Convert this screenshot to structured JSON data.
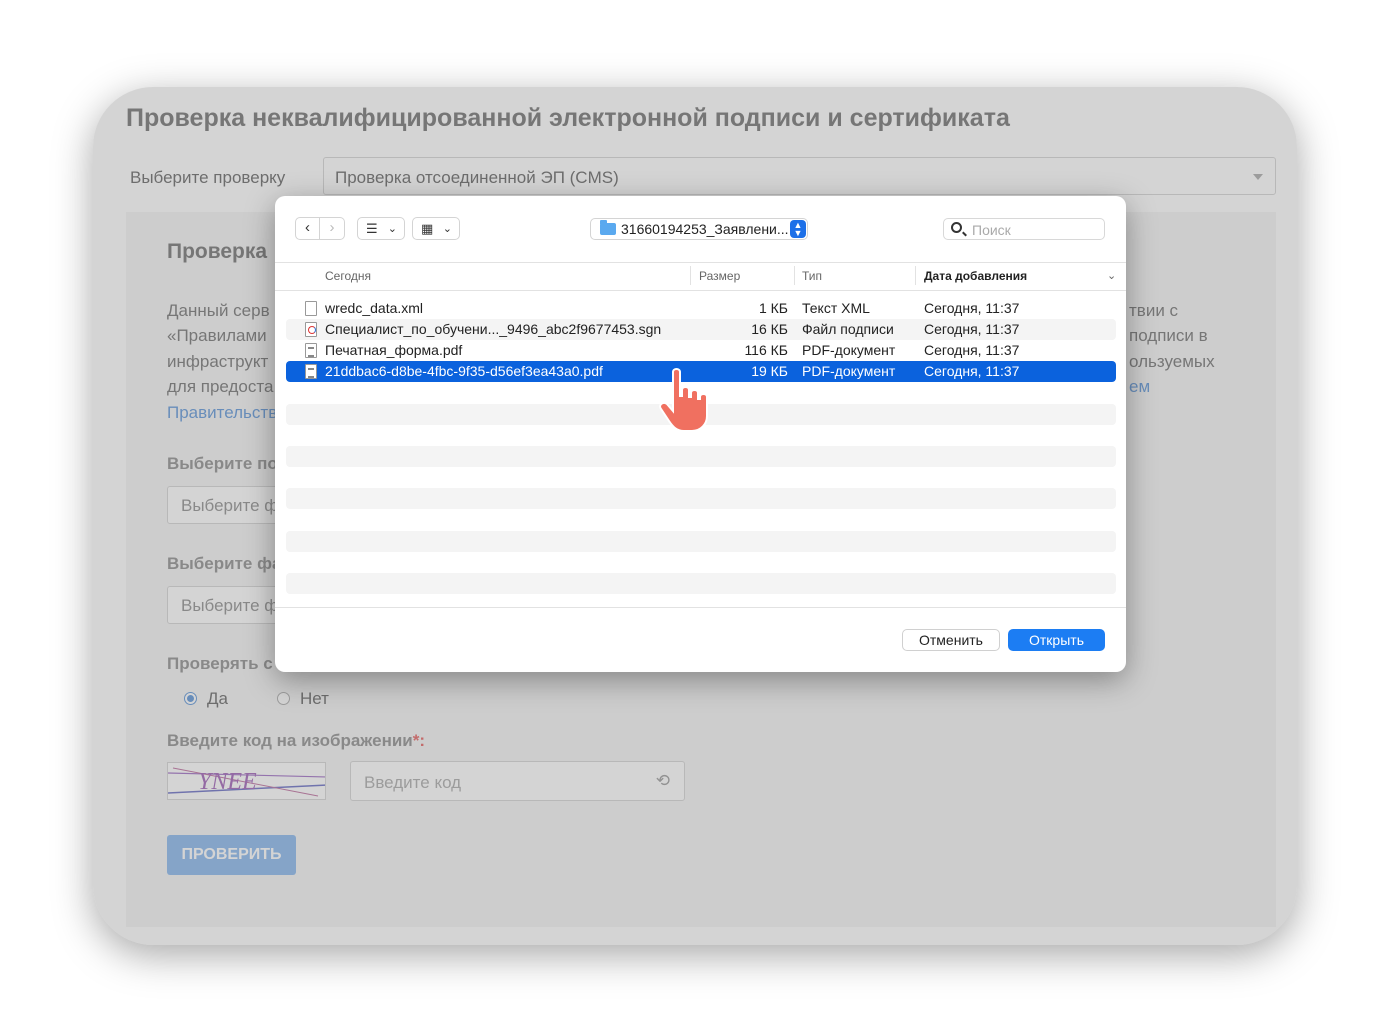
{
  "page": {
    "title": "Проверка неквалифицированной электронной подписи и сертификата",
    "choose_label": "Выберите проверку",
    "choose_value": "Проверка отсоединенной ЭП (CMS)",
    "panel_title": "Проверка",
    "desc_left": [
      "Данный серв",
      "«Правилами",
      "инфраструкт",
      "для предоста"
    ],
    "desc_link_left": "Правительств",
    "desc_right": [
      "твии с",
      "подписи в",
      "ользуемых",
      "ем"
    ],
    "field1_label": "Выберите по",
    "field1_placeholder": "Выберите ф",
    "field2_label": "Выберите фа",
    "field2_placeholder": "Выберите ф",
    "check_cert_label": "Проверять с",
    "radio_yes": "Да",
    "radio_no": "Нет",
    "captcha_label": "Введите код на изображении",
    "captcha_required": "*:",
    "captcha_text": "YNEE",
    "code_placeholder": "Введите код",
    "check_button": "ПРОВЕРИТЬ"
  },
  "dialog": {
    "folder_name": "31660194253_Заявлени...",
    "search_placeholder": "Поиск",
    "columns": {
      "name": "Сегодня",
      "size": "Размер",
      "type": "Тип",
      "date": "Дата добавления"
    },
    "files": [
      {
        "name": "wredc_data.xml",
        "size": "1 КБ",
        "type": "Текст XML",
        "date": "Сегодня, 11:37",
        "icon": "xml-file-icon",
        "selected": false
      },
      {
        "name": "Специалист_по_обучени..._9496_abc2f9677453.sgn",
        "size": "16 КБ",
        "type": "Файл подписи",
        "date": "Сегодня, 11:37",
        "icon": "signature-file-icon",
        "selected": false
      },
      {
        "name": "Печатная_форма.pdf",
        "size": "116 КБ",
        "type": "PDF-документ",
        "date": "Сегодня, 11:37",
        "icon": "pdf-file-icon",
        "selected": false
      },
      {
        "name": "21ddbac6-d8be-4fbc-9f35-d56ef3ea43a0.pdf",
        "size": "19 КБ",
        "type": "PDF-документ",
        "date": "Сегодня, 11:37",
        "icon": "pdf-file-icon",
        "selected": true
      }
    ],
    "cancel_button": "Отменить",
    "open_button": "Открыть"
  },
  "colors": {
    "selection": "#0b62dd",
    "primary_button": "#1c7df3",
    "link": "#3b7fd0"
  }
}
